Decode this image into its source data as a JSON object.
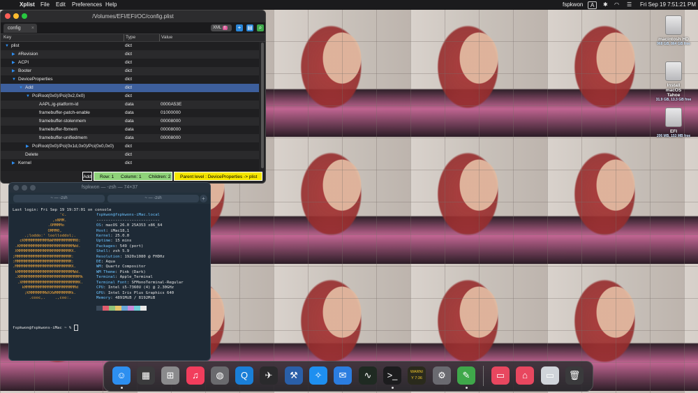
{
  "menubar": {
    "app": "Xplist",
    "items": [
      "File",
      "Edit",
      "Preferences",
      "Help"
    ],
    "user": "fspkwon",
    "input": "A",
    "datetime": "Fri Sep 19  7:51:21 PM"
  },
  "desktop_icons": [
    {
      "name": "macintosh HD",
      "sub": "968 GB, 864 GB free"
    },
    {
      "name": "Install macOS Tahoe",
      "sub": "31.9 GB, 13.3 GB free"
    },
    {
      "name": "EFI",
      "sub": "206 MB, 153 MB free"
    }
  ],
  "xplist": {
    "title": "/Volumes/EFI/EFI/OC/config.plist",
    "tab": "config",
    "format": "XML",
    "columns": {
      "key": "Key",
      "type": "Type",
      "value": "Value"
    },
    "rows": [
      {
        "key": "plist",
        "type": "dict",
        "value": "",
        "indent": 0,
        "arrow": "open"
      },
      {
        "key": "#Revision",
        "type": "dict",
        "value": "",
        "indent": 1,
        "arrow": "closed"
      },
      {
        "key": "ACPI",
        "type": "dict",
        "value": "",
        "indent": 1,
        "arrow": "closed"
      },
      {
        "key": "Booter",
        "type": "dict",
        "value": "",
        "indent": 1,
        "arrow": "closed"
      },
      {
        "key": "DeviceProperties",
        "type": "dict",
        "value": "",
        "indent": 1,
        "arrow": "open"
      },
      {
        "key": "Add",
        "type": "dict",
        "value": "",
        "indent": 2,
        "arrow": "open",
        "selected": true
      },
      {
        "key": "PciRoot(0x0)/Pci(0x2,0x0)",
        "type": "dict",
        "value": "",
        "indent": 3,
        "arrow": "open"
      },
      {
        "key": "AAPL,ig-platform-id",
        "type": "data",
        "value": "0000A53E",
        "indent": 4,
        "arrow": ""
      },
      {
        "key": "framebuffer-patch-enable",
        "type": "data",
        "value": "01000000",
        "indent": 4,
        "arrow": ""
      },
      {
        "key": "framebuffer-stolenmem",
        "type": "data",
        "value": "00008000",
        "indent": 4,
        "arrow": ""
      },
      {
        "key": "framebuffer-fbmem",
        "type": "data",
        "value": "00008000",
        "indent": 4,
        "arrow": ""
      },
      {
        "key": "framebuffer-unifiedmem",
        "type": "data",
        "value": "00008000",
        "indent": 4,
        "arrow": ""
      },
      {
        "key": "PciRoot(0x0)/Pci(0x1d,0x0)/Pci(0x0,0x0)",
        "type": "dict",
        "value": "",
        "indent": 3,
        "arrow": "closed"
      },
      {
        "key": "Delete",
        "type": "dict",
        "value": "",
        "indent": 2,
        "arrow": ""
      },
      {
        "key": "Kernel",
        "type": "dict",
        "value": "",
        "indent": 1,
        "arrow": "closed"
      }
    ],
    "status": {
      "key": "Add",
      "row": "Row: 1",
      "column": "Column: 1",
      "children": "Children: 2",
      "parent": "Parent level : DeviceProperties -> plist"
    }
  },
  "terminal": {
    "title": "fspkwon — -zsh — 74×37",
    "tabs": [
      "~ — -zsh",
      "~ — -zsh"
    ],
    "login": "Last login: Fri Sep 19 19:37:01 on console",
    "logo": [
      "                    'c.",
      "                 ,xNMM.",
      "               .OMMMMo",
      "               OMMM0,",
      "     .;loddo:' loolloddol;.",
      "   cKMMMMMMMMMMNWMMMMMMMMMM0:",
      " .KMMMMMMMMMMMMMMMMMMMMMMMWd.",
      " XMMMMMMMMMMMMMMMMMMMMMMMX.",
      ";MMMMMMMMMMMMMMMMMMMMMMMM:",
      ":MMMMMMMMMMMMMMMMMMMMMMMM:",
      ".MMMMMMMMMMMMMMMMMMMMMMMMX.",
      " kMMMMMMMMMMMMMMMMMMMMMMMMWd.",
      " .XMMMMMMMMMMMMMMMMMMMMMMMMMMk",
      "  .XMMMMMMMMMMMMMMMMMMMMMMMMK.",
      "    kMMMMMMMMMMMMMMMMMMMMMMd",
      "     ;KMMMMMMMWXXWMMMMMMMk.",
      "       .cooc,.    .,coo:."
    ],
    "info_header": "fspkwon@fspkwons-iMac.local",
    "info_sep": "---------------------------",
    "info": [
      {
        "label": "OS",
        "value": "macOS 26.0 25A353 x86_64"
      },
      {
        "label": "Host",
        "value": "iMac18,1"
      },
      {
        "label": "Kernel",
        "value": "25.0.0"
      },
      {
        "label": "Uptime",
        "value": "15 mins"
      },
      {
        "label": "Packages",
        "value": "549 (port)"
      },
      {
        "label": "Shell",
        "value": "zsh 5.9"
      },
      {
        "label": "Resolution",
        "value": "1920x1080 @ FHDHz"
      },
      {
        "label": "DE",
        "value": "Aqua"
      },
      {
        "label": "WM",
        "value": "Quartz Compositor"
      },
      {
        "label": "WM Theme",
        "value": "Pink (Dark)"
      },
      {
        "label": "Terminal",
        "value": "Apple_Terminal"
      },
      {
        "label": "Terminal Font",
        "value": "SFMonoTerminal-Regular"
      },
      {
        "label": "CPU",
        "value": "Intel i5-7360U (4) @ 2.30GHz"
      },
      {
        "label": "GPU",
        "value": "Intel Iris Plus Graphics 640"
      },
      {
        "label": "Memory",
        "value": "4891MiB / 8192MiB"
      }
    ],
    "swatches": [
      "#3b4a5a",
      "#e25d6e",
      "#8fc27a",
      "#e6c36a",
      "#6aa6d8",
      "#c98bd8",
      "#6fd0d8",
      "#e8e8e8"
    ],
    "prompt": "fspkwon@fspkwons-iMac ~ % "
  },
  "dock": {
    "items": [
      {
        "icon": "finder-icon",
        "glyph": "☺",
        "color": "#2d8ff0",
        "dot": true
      },
      {
        "icon": "mission-control-icon",
        "glyph": "▦",
        "color": "#3a3a3c",
        "dot": false
      },
      {
        "icon": "calculator-icon",
        "glyph": "⊞",
        "color": "#8a8a8c",
        "dot": false
      },
      {
        "icon": "music-icon",
        "glyph": "♫",
        "color": "#f23d5c",
        "dot": false
      },
      {
        "icon": "disk-utility-icon",
        "glyph": "◍",
        "color": "#6a6a6e",
        "dot": false
      },
      {
        "icon": "quicktime-icon",
        "glyph": "Q",
        "color": "#1a7fd8",
        "dot": false
      },
      {
        "icon": "game-controller-icon",
        "glyph": "✈",
        "color": "#2a2a2c",
        "dot": false
      },
      {
        "icon": "xcode-icon",
        "glyph": "⚒",
        "color": "#2a5fa8",
        "dot": false
      },
      {
        "icon": "safari-icon",
        "glyph": "✧",
        "color": "#1e8ff0",
        "dot": false
      },
      {
        "icon": "mail-icon",
        "glyph": "✉",
        "color": "#2b7de0",
        "dot": false
      },
      {
        "icon": "activity-monitor-icon",
        "glyph": "∿",
        "color": "#1f2a22",
        "dot": false
      },
      {
        "icon": "terminal-icon",
        "glyph": ">_",
        "color": "#1c1c1e",
        "dot": true
      },
      {
        "icon": "console-icon",
        "glyph": "WARNI\nY 7:36",
        "color": "#2a2a1c",
        "dot": false
      },
      {
        "icon": "system-settings-icon",
        "glyph": "⚙",
        "color": "#6a6a70",
        "dot": false
      },
      {
        "icon": "xplist-icon",
        "glyph": "✎",
        "color": "#3fa84a",
        "dot": true
      },
      {
        "icon": "applications-folder-icon",
        "glyph": "▭",
        "color": "#e8475f",
        "dot": false
      },
      {
        "icon": "home-folder-icon",
        "glyph": "⌂",
        "color": "#e8475f",
        "dot": false
      },
      {
        "icon": "screenshot-icon",
        "glyph": "▭",
        "color": "#d0d4da",
        "dot": false
      },
      {
        "icon": "trash-icon",
        "glyph": "🗑",
        "color": "#3a3a3c",
        "dot": false
      }
    ]
  }
}
